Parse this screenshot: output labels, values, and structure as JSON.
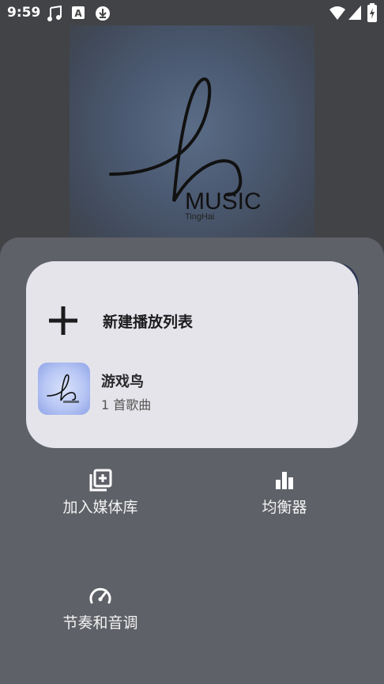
{
  "status_bar": {
    "time": "9:59",
    "left_icons": [
      "music-note-icon",
      "font-a-icon",
      "download-circle-icon"
    ],
    "right_icons": [
      "wifi-icon",
      "signal-icon",
      "battery-charging-icon"
    ]
  },
  "album_art": {
    "logo_text": "MUSIC",
    "logo_subtext": "TingHai"
  },
  "dialog": {
    "new_playlist_label": "新建播放列表",
    "playlists": [
      {
        "name": "游戏鸟",
        "count": "1 首歌曲"
      }
    ]
  },
  "sheet": {
    "items": [
      {
        "label": "加入媒体库",
        "icon": "library-add-icon"
      },
      {
        "label": "均衡器",
        "icon": "equalizer-icon"
      },
      {
        "label": "节奏和音调",
        "icon": "speedometer-icon"
      }
    ]
  }
}
